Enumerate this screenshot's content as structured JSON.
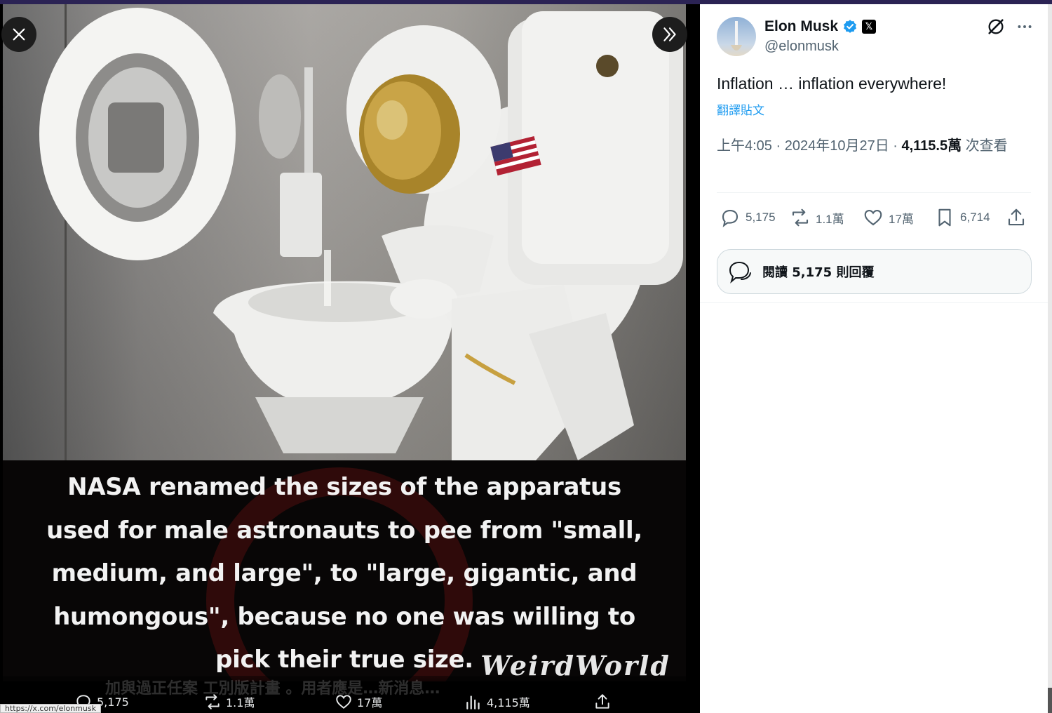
{
  "media": {
    "caption": "NASA renamed the sizes of the apparatus used for male astronauts to pee from \"small, medium, and large\", to \"large, gigantic, and humongous\", because no one was willing to pick their true size.",
    "signature": "WeirdWorld",
    "ghost_text": "加與過正任案 工別版計畫 。用者應是…新消息…",
    "actions": {
      "replies": "5,175",
      "reposts": "1.1萬",
      "likes": "17萬",
      "views": "4,115萬"
    },
    "status_url": "https://x.com/elonmusk"
  },
  "tweet": {
    "author_name": "Elon Musk",
    "author_handle": "@elonmusk",
    "text": "Inflation … inflation everywhere!",
    "translate_label": "翻譯貼文",
    "time": "上午4:05",
    "date": "2024年10月27日",
    "views_count": "4,115.5萬",
    "views_label": "次查看",
    "separator": " · ",
    "stats": {
      "replies": "5,175",
      "reposts": "1.1萬",
      "likes": "17萬",
      "bookmarks": "6,714"
    },
    "read_replies_label": "閱讀 5,175 則回覆"
  },
  "colors": {
    "verified_blue": "#1d9bf0",
    "text_primary": "#0f1419",
    "text_secondary": "#536471",
    "top_bar": "#2b2354"
  },
  "icons": [
    "close-icon",
    "double-chevron-right-icon",
    "verified-badge-icon",
    "x-badge-icon",
    "grok-icon",
    "more-icon",
    "reply-icon",
    "repost-icon",
    "like-icon",
    "bookmark-icon",
    "share-icon",
    "views-icon",
    "replies-bubble-icon"
  ]
}
